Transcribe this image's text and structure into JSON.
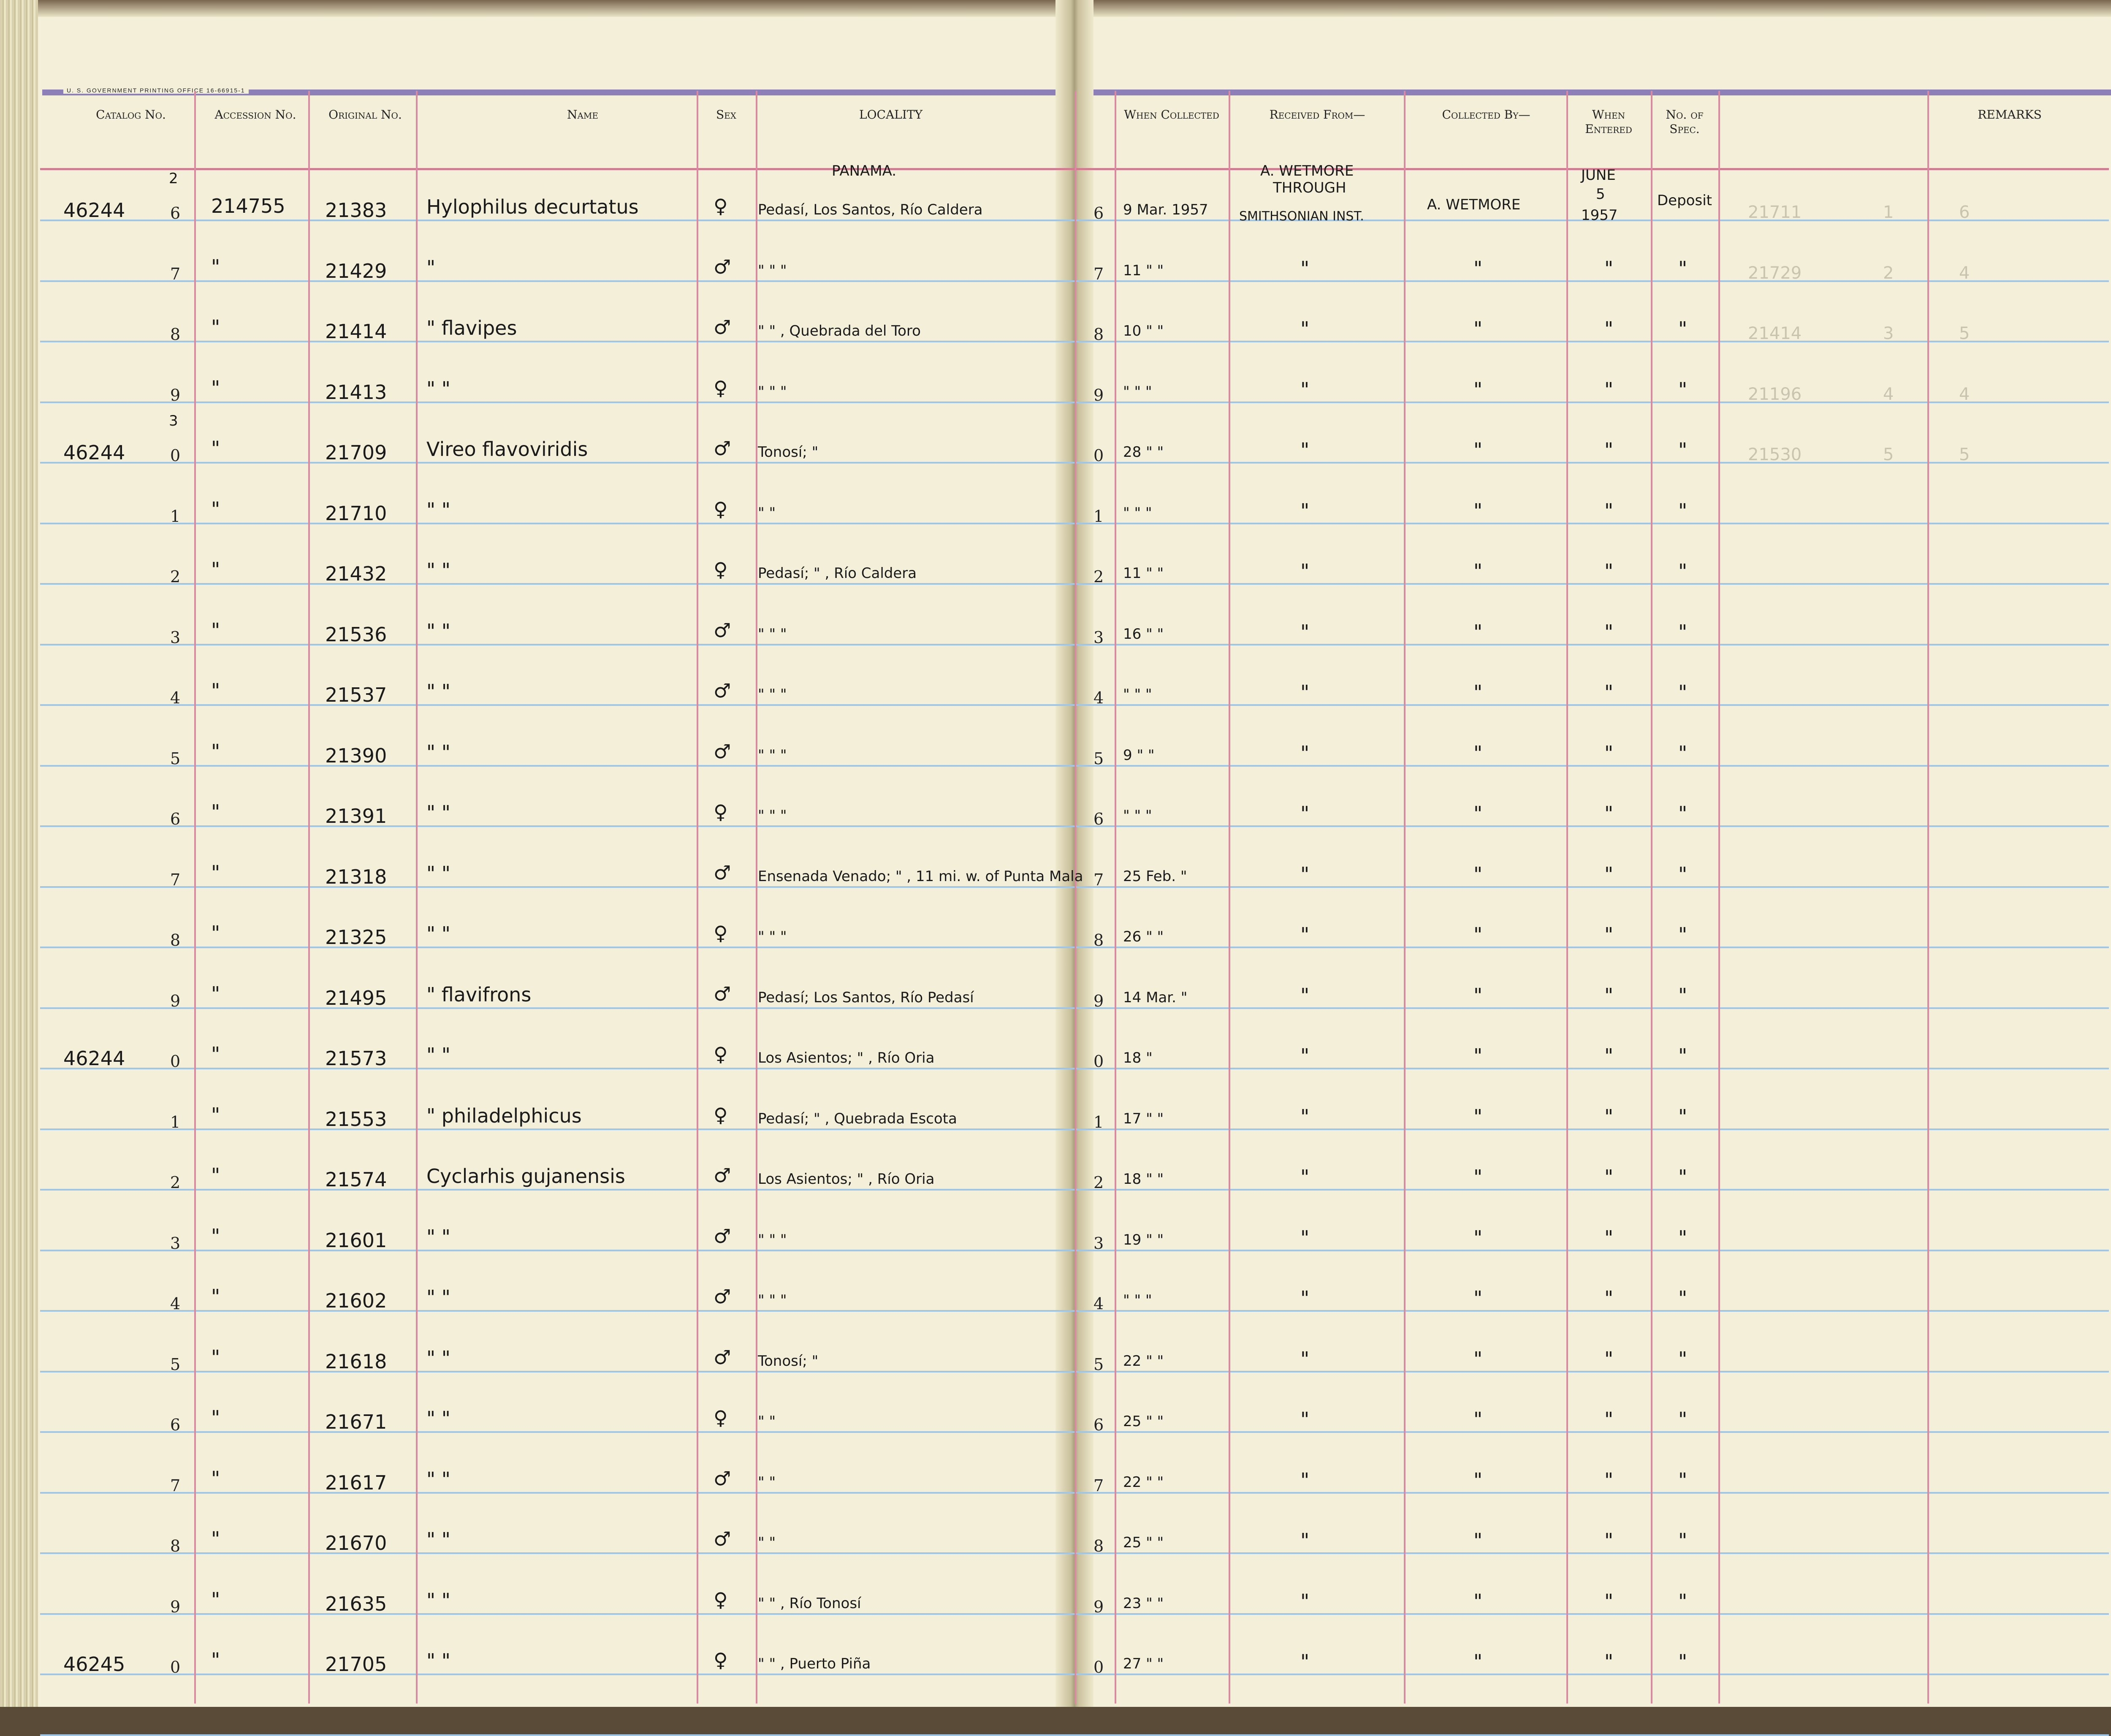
{
  "header": {
    "printing_office": "U. S. GOVERNMENT PRINTING OFFICE   16-66915-1",
    "left": [
      {
        "key": "catalog",
        "label": "Catalog No."
      },
      {
        "key": "accession",
        "label": "Accession No."
      },
      {
        "key": "original",
        "label": "Original No."
      },
      {
        "key": "name",
        "label": "Name"
      },
      {
        "key": "sex",
        "label": "Sex"
      },
      {
        "key": "locality",
        "label": "LOCALITY"
      }
    ],
    "right": [
      {
        "key": "when_collected",
        "label": "When Collected"
      },
      {
        "key": "received_from",
        "label": "Received From—"
      },
      {
        "key": "collected_by",
        "label": "Collected By—"
      },
      {
        "key": "when_entered",
        "label": "When Entered"
      },
      {
        "key": "no_spec",
        "label": "No. of Spec."
      },
      {
        "key": "remarks",
        "label": "REMARKS"
      }
    ]
  },
  "top_notes": {
    "country": "PANAMA.",
    "received_line1": "A. WETMORE",
    "received_line2": "THROUGH",
    "received_line3": "SMITHSONIAN INST.",
    "collected": "A. WETMORE",
    "entered_line1": "JUNE",
    "entered_line2": "5",
    "entered_line3": "1957",
    "spec": "Deposit"
  },
  "rows": [
    {
      "catalog": "46244",
      "catalog_sup": "2",
      "digit": "6",
      "accession": "214755",
      "original": "21383",
      "name": "Hylophilus  decurtatus",
      "sex": "♀",
      "locality": "Pedasí, Los Santos, Río Caldera",
      "when": "9 Mar. 1957"
    },
    {
      "catalog": "",
      "catalog_sup": "",
      "digit": "7",
      "accession": "\"",
      "original": "21429",
      "name": "\"",
      "sex": "♂",
      "locality": "\"      \"      \"",
      "when": "11  \"   \""
    },
    {
      "catalog": "",
      "catalog_sup": "",
      "digit": "8",
      "accession": "\"",
      "original": "21414",
      "name": "\"     flavipes",
      "sex": "♂",
      "locality": "\"     \" ,  Quebrada del Toro",
      "when": "10  \"   \""
    },
    {
      "catalog": "",
      "catalog_sup": "",
      "digit": "9",
      "accession": "\"",
      "original": "21413",
      "name": "\"       \"",
      "sex": "♀",
      "locality": "\"      \"      \"",
      "when": "\"   \"   \""
    },
    {
      "catalog": "46244",
      "catalog_sup": "3",
      "digit": "0",
      "accession": "\"",
      "original": "21709",
      "name": "Vireo  flavoviridis",
      "sex": "♂",
      "locality": "Tonosí;  \"",
      "when": "28  \"   \""
    },
    {
      "catalog": "",
      "catalog_sup": "",
      "digit": "1",
      "accession": "\"",
      "original": "21710",
      "name": "\"         \"",
      "sex": "♀",
      "locality": "\"      \"",
      "when": "\"   \"   \""
    },
    {
      "catalog": "",
      "catalog_sup": "",
      "digit": "2",
      "accession": "\"",
      "original": "21432",
      "name": "\"         \"",
      "sex": "♀",
      "locality": "Pedasí;  \" ,  Río Caldera",
      "when": "11  \"   \""
    },
    {
      "catalog": "",
      "catalog_sup": "",
      "digit": "3",
      "accession": "\"",
      "original": "21536",
      "name": "\"         \"",
      "sex": "♂",
      "locality": "\"      \"      \"",
      "when": "16  \"   \""
    },
    {
      "catalog": "",
      "catalog_sup": "",
      "digit": "4",
      "accession": "\"",
      "original": "21537",
      "name": "\"         \"",
      "sex": "♂",
      "locality": "\"      \"      \"",
      "when": "\"   \"   \""
    },
    {
      "catalog": "",
      "catalog_sup": "",
      "digit": "5",
      "accession": "\"",
      "original": "21390",
      "name": "\"         \"",
      "sex": "♂",
      "locality": "\"      \"      \"",
      "when": "9  \"   \""
    },
    {
      "catalog": "",
      "catalog_sup": "",
      "digit": "6",
      "accession": "\"",
      "original": "21391",
      "name": "\"         \"",
      "sex": "♀",
      "locality": "\"      \"      \"",
      "when": "\"   \"   \""
    },
    {
      "catalog": "",
      "catalog_sup": "",
      "digit": "7",
      "accession": "\"",
      "original": "21318",
      "name": "\"         \"",
      "sex": "♂",
      "locality": "Ensenada Venado; \" ,  11 mi. w. of Punta Mala",
      "when": "25 Feb.  \""
    },
    {
      "catalog": "",
      "catalog_sup": "",
      "digit": "8",
      "accession": "\"",
      "original": "21325",
      "name": "\"         \"",
      "sex": "♀",
      "locality": "\"      \"      \"",
      "when": "26  \"   \""
    },
    {
      "catalog": "",
      "catalog_sup": "",
      "digit": "9",
      "accession": "\"",
      "original": "21495",
      "name": "\"     flavifrons",
      "sex": "♂",
      "locality": "Pedasí; Los Santos, Río Pedasí",
      "when": "14 Mar.  \""
    },
    {
      "catalog": "46244",
      "catalog_sup": "",
      "digit": "0",
      "accession": "\"",
      "original": "21573",
      "name": "\"         \"",
      "sex": "♀",
      "locality": "Los Asientos;  \" ,  Río Oria",
      "when": "18  \""
    },
    {
      "catalog": "",
      "catalog_sup": "",
      "digit": "1",
      "accession": "\"",
      "original": "21553",
      "name": "\"   philadelphicus",
      "sex": "♀",
      "locality": "Pedasí;  \" ,  Quebrada Escota",
      "when": "17  \"   \""
    },
    {
      "catalog": "",
      "catalog_sup": "",
      "digit": "2",
      "accession": "\"",
      "original": "21574",
      "name": "Cyclarhis  gujanensis",
      "sex": "♂",
      "locality": "Los Asientos;  \" ,  Río Oria",
      "when": "18  \"   \""
    },
    {
      "catalog": "",
      "catalog_sup": "",
      "digit": "3",
      "accession": "\"",
      "original": "21601",
      "name": "\"         \"",
      "sex": "♂",
      "locality": "\"      \"      \"",
      "when": "19  \"   \""
    },
    {
      "catalog": "",
      "catalog_sup": "",
      "digit": "4",
      "accession": "\"",
      "original": "21602",
      "name": "\"         \"",
      "sex": "♂",
      "locality": "\"      \"      \"",
      "when": "\"   \"   \""
    },
    {
      "catalog": "",
      "catalog_sup": "",
      "digit": "5",
      "accession": "\"",
      "original": "21618",
      "name": "\"         \"",
      "sex": "♂",
      "locality": "Tonosí;  \"",
      "when": "22  \"   \""
    },
    {
      "catalog": "",
      "catalog_sup": "",
      "digit": "6",
      "accession": "\"",
      "original": "21671",
      "name": "\"         \"",
      "sex": "♀",
      "locality": "\"      \"",
      "when": "25  \"   \""
    },
    {
      "catalog": "",
      "catalog_sup": "",
      "digit": "7",
      "accession": "\"",
      "original": "21617",
      "name": "\"         \"",
      "sex": "♂",
      "locality": "\"      \"",
      "when": "22  \"   \""
    },
    {
      "catalog": "",
      "catalog_sup": "",
      "digit": "8",
      "accession": "\"",
      "original": "21670",
      "name": "\"         \"",
      "sex": "♂",
      "locality": "\"      \"",
      "when": "25  \"   \""
    },
    {
      "catalog": "",
      "catalog_sup": "",
      "digit": "9",
      "accession": "\"",
      "original": "21635",
      "name": "\"         \"",
      "sex": "♀",
      "locality": "\"      \" ,  Río Tonosí",
      "when": "23  \"   \""
    },
    {
      "catalog": "46245",
      "catalog_sup": "",
      "digit": "0",
      "accession": "\"",
      "original": "21705",
      "name": "\"         \"",
      "sex": "♀",
      "locality": "\"      \" ,  Puerto Piña",
      "when": "27  \"   \""
    }
  ],
  "ditto": "\"",
  "ghost_right": [
    {
      "original": "21711",
      "accession": "1",
      "sex": "6"
    },
    {
      "original": "21729",
      "accession": "2",
      "sex": "4"
    },
    {
      "original": "21414",
      "accession": "3",
      "sex": "5"
    },
    {
      "original": "21196",
      "accession": "4",
      "sex": "4"
    },
    {
      "original": "21530",
      "accession": "5",
      "sex": "5"
    }
  ]
}
